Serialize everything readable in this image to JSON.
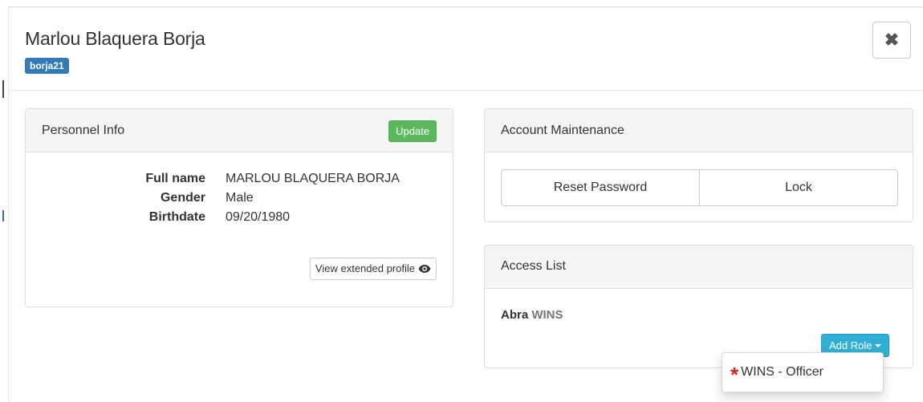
{
  "modal": {
    "title": "Marlou Blaquera Borja",
    "username_badge": "borja21",
    "close_label": "✖"
  },
  "personnel_info": {
    "heading": "Personnel Info",
    "update_label": "Update",
    "fields": [
      {
        "label": "Full name",
        "value": "MARLOU BLAQUERA BORJA"
      },
      {
        "label": "Gender",
        "value": "Male"
      },
      {
        "label": "Birthdate",
        "value": "09/20/1980"
      }
    ],
    "view_profile_label": "View extended profile"
  },
  "account_maintenance": {
    "heading": "Account Maintenance",
    "reset_password_label": "Reset Password",
    "lock_label": "Lock"
  },
  "access_list": {
    "heading": "Access List",
    "entry_location": "Abra",
    "entry_system": "WINS",
    "add_role_label": "Add Role"
  },
  "role_dropdown": {
    "items": [
      {
        "marker": "*",
        "label": "WINS - Officer",
        "marker_color": "#d9231d"
      }
    ]
  },
  "colors": {
    "primary_badge": "#337ab7",
    "success_button": "#5cb85c",
    "info_button": "#31b0d5"
  }
}
